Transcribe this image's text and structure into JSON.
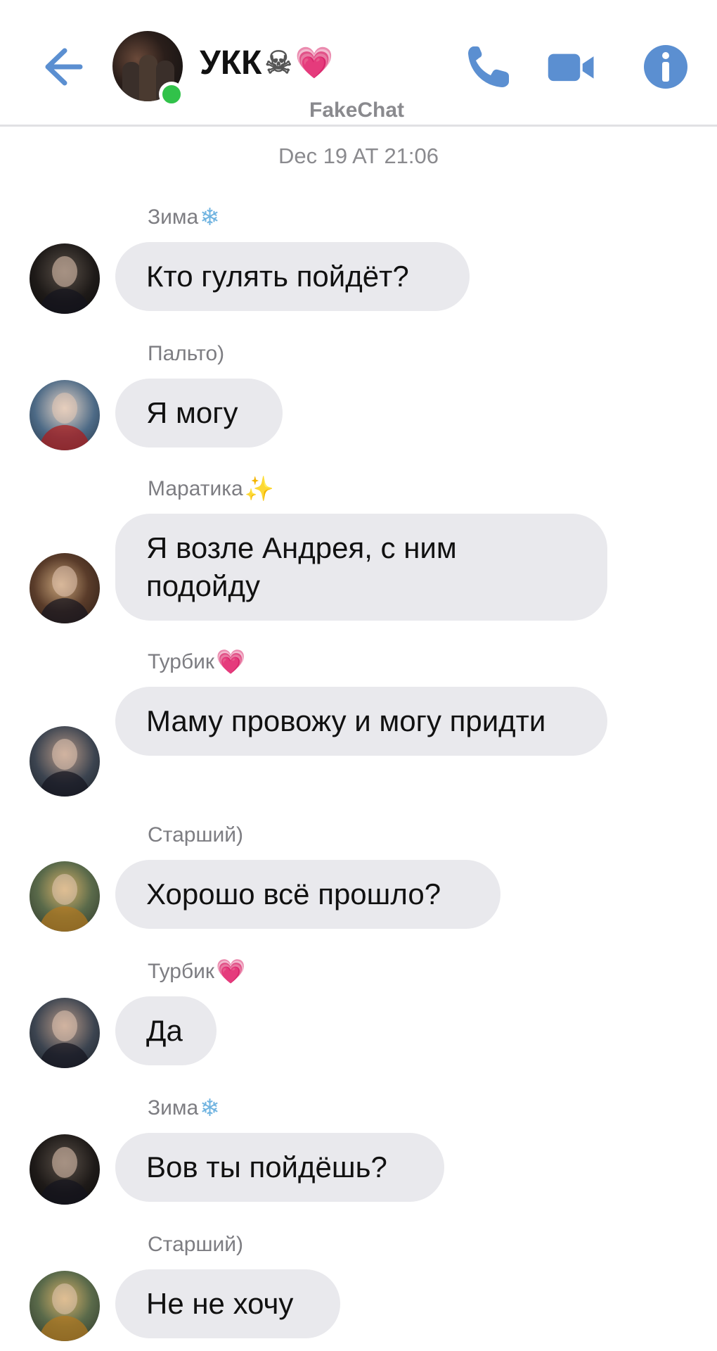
{
  "header": {
    "title": "УКК",
    "title_emojis": [
      "☠",
      "💗"
    ],
    "subtitle": "FakeChat",
    "online": true,
    "accent_color": "#5b8fd1",
    "icons": [
      "back-arrow-icon",
      "phone-icon",
      "video-camera-icon",
      "info-icon"
    ]
  },
  "date_label": "Dec 19 AT 21:06",
  "messages": [
    {
      "sender": "Зима",
      "sender_emoji": "❄",
      "text": "Кто гулять пойдёт?"
    },
    {
      "sender": "Пальто)",
      "sender_emoji": "",
      "text": "Я могу"
    },
    {
      "sender": "Маратика",
      "sender_emoji": "✨",
      "text": "Я возле Андрея, с ним подойду"
    },
    {
      "sender": "Турбик",
      "sender_emoji": "💗",
      "text": "Маму провожу и могу придти"
    },
    {
      "sender": "Старший)",
      "sender_emoji": "",
      "text": "Хорошо всё прошло?"
    },
    {
      "sender": "Турбик",
      "sender_emoji": "💗",
      "text": "Да"
    },
    {
      "sender": "Зима",
      "sender_emoji": "❄",
      "text": "Вов ты пойдёшь?"
    },
    {
      "sender": "Старший)",
      "sender_emoji": "",
      "text": "Не не хочу"
    }
  ]
}
